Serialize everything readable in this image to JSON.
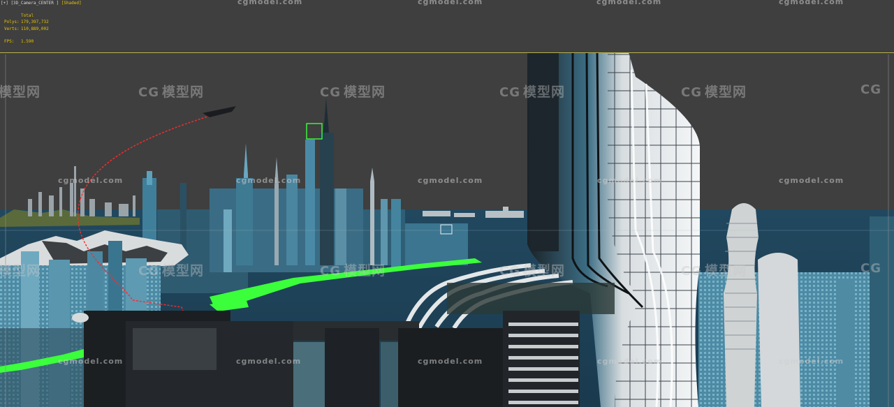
{
  "viewport": {
    "label_prefix": "[+] [3D_Camera_CENTER ]",
    "shading_mode": "[Shaded]",
    "accent_color": "#e6c200",
    "background_color": "#3f3f3f"
  },
  "stats": {
    "header": "Total",
    "polys_label": "Polys:",
    "polys_value": "179,397,732",
    "verts_label": "Verts:",
    "verts_value": "110,889,002",
    "fps_label": "FPS:",
    "fps_value": "1.590"
  },
  "watermarks": {
    "logo_text": "模型网",
    "logo_mark": "CG",
    "url_text": "cgmodel.com"
  },
  "scene": {
    "selection_color": "#3cff3c",
    "path_color": "#ff2a2a"
  }
}
